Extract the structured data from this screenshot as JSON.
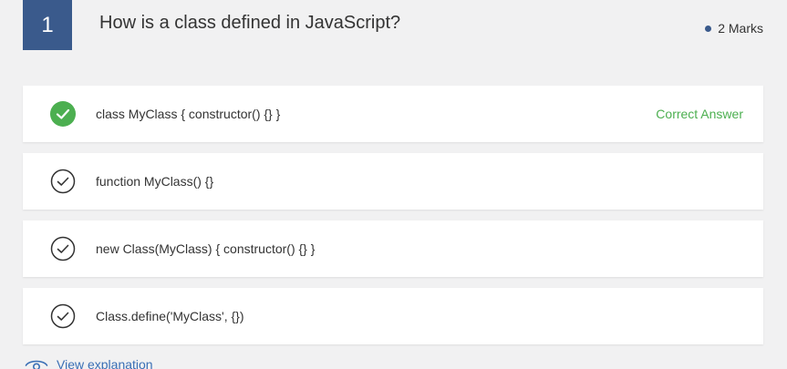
{
  "question": {
    "number": "1",
    "text": "How is a class defined in JavaScript?",
    "marks": "2 Marks"
  },
  "options": [
    {
      "label": "class MyClass { constructor() {} }",
      "status": "Correct Answer"
    },
    {
      "label": "function MyClass() {}"
    },
    {
      "label": "new Class(MyClass) { constructor() {} }"
    },
    {
      "label": "Class.define('MyClass', {})"
    }
  ],
  "explanation": {
    "label": "View explanation"
  },
  "colors": {
    "accent": "#3a5a8c",
    "correct": "#4caf50",
    "link": "#3a6fb5"
  },
  "icons": {
    "correct": "check-circle-filled-icon",
    "option": "check-circle-outline-icon",
    "explanation": "eye-icon"
  }
}
